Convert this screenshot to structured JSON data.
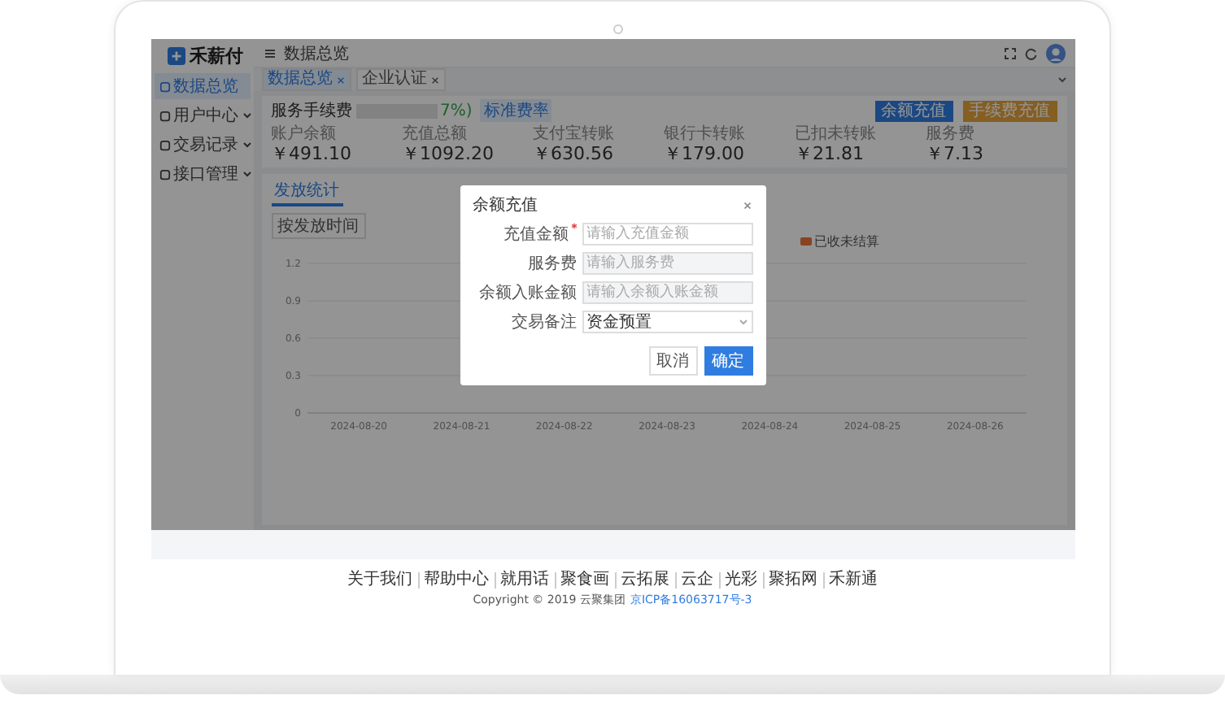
{
  "logo": {
    "text": "禾薪付"
  },
  "header": {
    "breadcrumb": "数据总览"
  },
  "sidebar": {
    "items": [
      {
        "label": "数据总览",
        "selected": true,
        "has_submenu": false
      },
      {
        "label": "用户中心",
        "selected": false,
        "has_submenu": true
      },
      {
        "label": "交易记录",
        "selected": false,
        "has_submenu": true
      },
      {
        "label": "接口管理",
        "selected": false,
        "has_submenu": true
      }
    ]
  },
  "tabs": [
    {
      "label": "数据总览",
      "selected": true
    },
    {
      "label": "企业认证",
      "selected": false
    }
  ],
  "fee": {
    "label": "服务手续费",
    "rate": "7%)",
    "tag": "标准费率"
  },
  "actions": [
    {
      "label": "余额充值",
      "kind": "primary"
    },
    {
      "label": "手续费充值",
      "kind": "warning"
    }
  ],
  "stats": [
    {
      "label": "账户余额",
      "value": "￥491.10"
    },
    {
      "label": "充值总额",
      "value": "￥1092.20"
    },
    {
      "label": "支付宝转账",
      "value": "￥630.56"
    },
    {
      "label": "银行卡转账",
      "value": "￥179.00"
    },
    {
      "label": "已扣未转账",
      "value": "￥21.81"
    },
    {
      "label": "服务费",
      "value": "￥7.13"
    }
  ],
  "chart_card": {
    "tab": "发放统计",
    "filter": "按发放时间",
    "legend": [
      {
        "label": "已收未结算"
      }
    ],
    "y_ticks": [
      "1.2",
      "0.9",
      "0.6",
      "0.3",
      "0"
    ],
    "x_labels": [
      "2024-08-20",
      "2024-08-21",
      "2024-08-22",
      "2024-08-23",
      "2024-08-24",
      "2024-08-25",
      "2024-08-26"
    ]
  },
  "dialog": {
    "title": "余额充值",
    "fields": [
      {
        "label": "充值金额",
        "required": true,
        "kind": "input",
        "placeholder": "请输入充值金额",
        "disabled": false
      },
      {
        "label": "服务费",
        "required": false,
        "kind": "input",
        "placeholder": "请输入服务费",
        "disabled": true
      },
      {
        "label": "余额入账金额",
        "required": false,
        "kind": "input",
        "placeholder": "请输入余额入账金额",
        "disabled": true
      },
      {
        "label": "交易备注",
        "required": false,
        "kind": "select",
        "value": "资金预置",
        "disabled": false
      }
    ],
    "buttons": [
      {
        "label": "取消",
        "kind": "default"
      },
      {
        "label": "确定",
        "kind": "primary"
      }
    ]
  },
  "footer": {
    "links": [
      "关于我们",
      "帮助中心",
      "就用话",
      "聚食画",
      "云拓展",
      "云企",
      "光彩",
      "聚拓网",
      "禾新通"
    ],
    "copyright": "Copyright © 2019 云聚集团",
    "icp": "京ICP备16063717号-3"
  }
}
